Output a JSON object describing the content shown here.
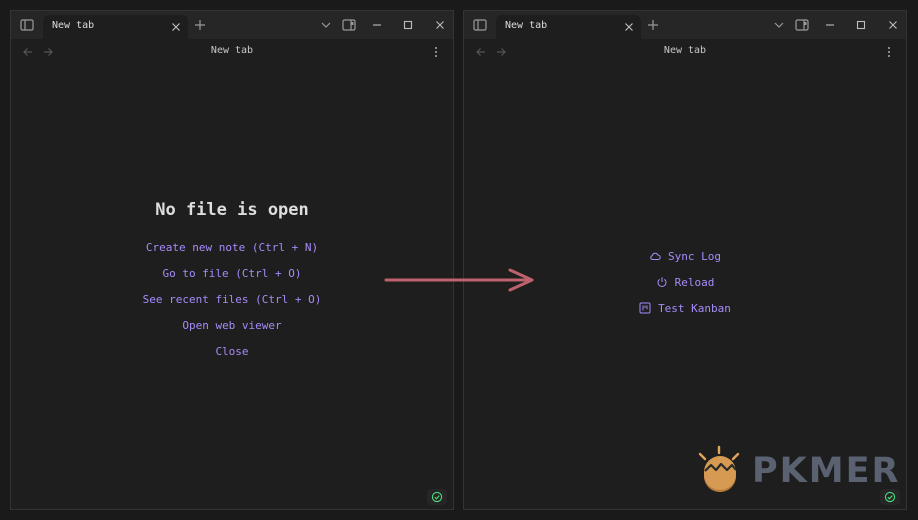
{
  "left_window": {
    "tab_title": "New tab",
    "nav_title": "New tab",
    "empty_state": {
      "title": "No file is open",
      "actions": [
        "Create new note (Ctrl + N)",
        "Go to file (Ctrl + O)",
        "See recent files (Ctrl + O)",
        "Open web viewer",
        "Close"
      ]
    }
  },
  "right_window": {
    "tab_title": "New tab",
    "nav_title": "New tab",
    "actions": [
      {
        "label": "Sync Log",
        "icon": "cloud-icon"
      },
      {
        "label": "Reload",
        "icon": "power-icon"
      },
      {
        "label": "Test Kanban",
        "icon": "kanban-icon"
      }
    ]
  },
  "watermark": {
    "brand": "PKMER"
  },
  "colors": {
    "accent": "#a78bfa",
    "arrow": "#c0626e",
    "status_ok": "#4ade80",
    "background": "#1e1e1e"
  }
}
